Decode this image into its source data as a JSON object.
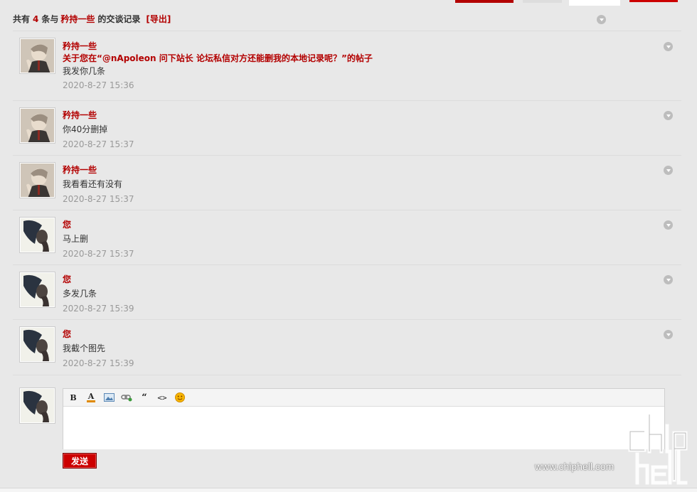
{
  "top": {},
  "summary": {
    "prefix": "共有",
    "count": "4",
    "mid": "条与",
    "partner": "矜持一些",
    "suffix": "的交谈记录",
    "export_label": "[导出]"
  },
  "messages": [
    {
      "author": "矜持一些",
      "avatar": "avatar-a",
      "subject": "关于您在“@nApoleon 问下站长 论坛私信对方还能删我的本地记录呢？”的帖子",
      "text": "我发你几条",
      "time": "2020-8-27 15:36"
    },
    {
      "author": "矜持一些",
      "avatar": "avatar-a",
      "text": "你40分删掉",
      "time": "2020-8-27 15:37"
    },
    {
      "author": "矜持一些",
      "avatar": "avatar-a",
      "text": "我看看还有没有",
      "time": "2020-8-27 15:37"
    },
    {
      "author": "您",
      "avatar": "avatar-b",
      "text": "马上删",
      "time": "2020-8-27 15:37"
    },
    {
      "author": "您",
      "avatar": "avatar-b",
      "text": "多发几条",
      "time": "2020-8-27 15:39"
    },
    {
      "author": "您",
      "avatar": "avatar-b",
      "text": "我截个图先",
      "time": "2020-8-27 15:39"
    }
  ],
  "editor": {
    "toolbar": [
      "bold-icon",
      "font-color-icon",
      "image-icon",
      "link-icon",
      "quote-icon",
      "code-icon",
      "smiley-icon"
    ],
    "bold_glyph": "B",
    "color_glyph": "A",
    "quote_glyph": "“",
    "code_glyph": "<>",
    "value": ""
  },
  "send_label": "发送",
  "watermark": {
    "logo": "chip hell",
    "url": "www.chiphell.com"
  },
  "colors": {
    "accent": "#b30000",
    "background": "#e8e8e8",
    "time": "#999999"
  }
}
